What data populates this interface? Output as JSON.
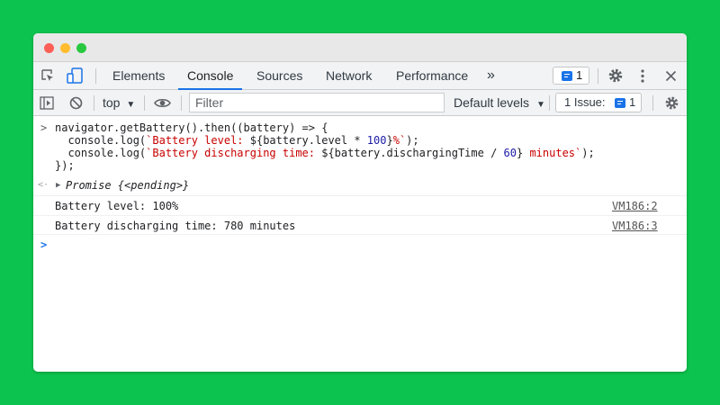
{
  "tabs": {
    "elements": "Elements",
    "console": "Console",
    "sources": "Sources",
    "network": "Network",
    "performance": "Performance",
    "more": "»",
    "messages_count": "1"
  },
  "toolbar": {
    "context": "top",
    "filter_placeholder": "Filter",
    "levels": "Default levels",
    "issues_label": "1 Issue:",
    "issues_count": "1"
  },
  "console": {
    "input_prompt": ">",
    "code_line1": "navigator.getBattery().then((battery) => {",
    "code_line2": {
      "pre": "  console.log(",
      "str1": "`Battery level: ",
      "mid": "${battery.level * ",
      "num": "100",
      "mid2": "}",
      "str2": "%`",
      "post": ");"
    },
    "code_line3": {
      "pre": "  console.log(",
      "str1": "`Battery discharging time: ",
      "mid": "${battery.dischargingTime / ",
      "num": "60",
      "mid2": "}",
      "str2": " minutes`",
      "post": ");"
    },
    "code_line4": "});",
    "result_prompt": "<·",
    "result_italic": "Promise {<pending>}",
    "log1": "Battery level: 100%",
    "log1_source": "VM186:2",
    "log2": "Battery discharging time: 780 minutes",
    "log2_source": "VM186:3",
    "new_prompt": ">"
  },
  "colors": {
    "background": "#0dc34f",
    "accent": "#1a73e8",
    "string": "#c80000",
    "number": "#1a1aa6"
  }
}
